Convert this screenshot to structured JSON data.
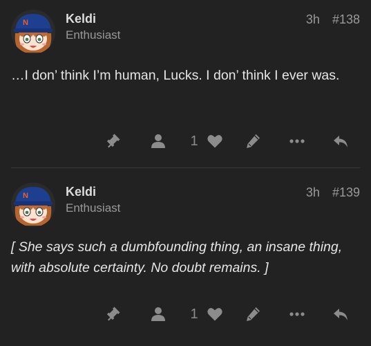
{
  "posts": [
    {
      "author": "Keldi",
      "user_title": "Enthusiast",
      "time": "3h",
      "post_number": "#138",
      "text": "…I don’ think I’m human, Lucks. I don’ think I ever was.",
      "italic": false,
      "like_count": "1",
      "icons": [
        "gavel-icon",
        "user-icon",
        "heart-icon",
        "pencil-icon",
        "ellipsis-icon",
        "reply-icon"
      ]
    },
    {
      "author": "Keldi",
      "user_title": "Enthusiast",
      "time": "3h",
      "post_number": "#139",
      "text": "[ She says such a dumbfounding thing, an insane thing, with absolute certainty. No doubt remains. ]",
      "italic": true,
      "like_count": "1",
      "icons": [
        "gavel-icon",
        "user-icon",
        "heart-icon",
        "pencil-icon",
        "ellipsis-icon",
        "reply-icon"
      ]
    }
  ],
  "colors": {
    "background": "#222222",
    "icon": "#8c8c8c",
    "username": "#dddddd",
    "meta": "#9a9a9a"
  }
}
